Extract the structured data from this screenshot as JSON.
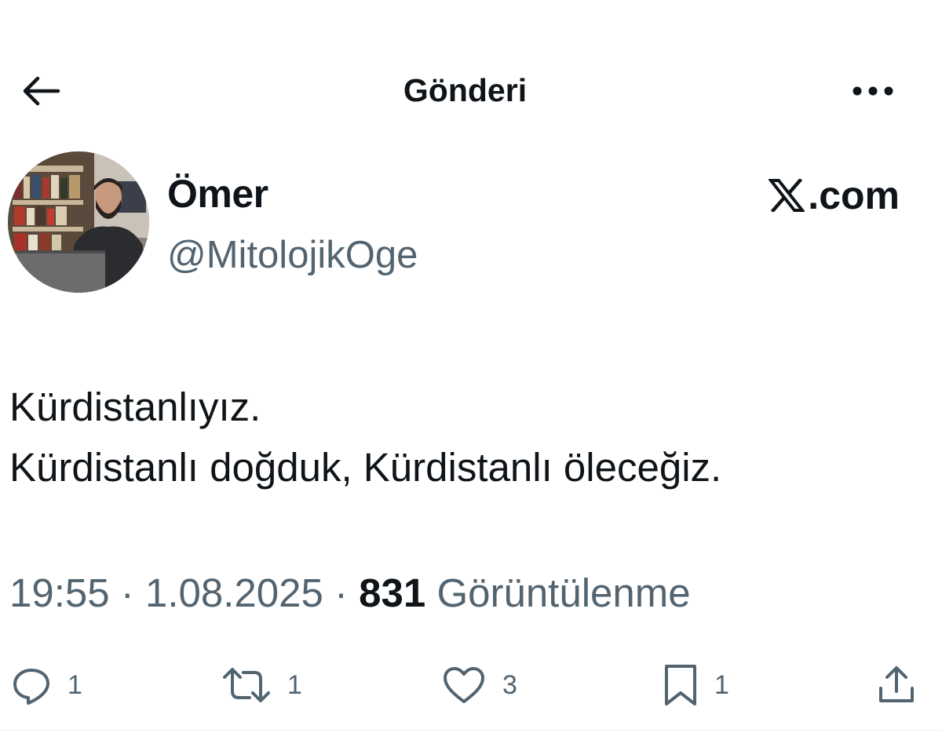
{
  "header": {
    "title": "Gönderi"
  },
  "author": {
    "name": "Ömer",
    "handle": "@MitolojikOge"
  },
  "brand": {
    "text": ".com"
  },
  "tweet": {
    "lines": [
      "Kürdistanlıyız.",
      "Kürdistanlı doğduk, Kürdistanlı öleceğiz."
    ]
  },
  "meta": {
    "time": "19:55",
    "separator": "·",
    "date": "1.08.2025",
    "views_count": "831",
    "views_label": "Görüntülenme"
  },
  "actions": {
    "reply_count": "1",
    "retweet_count": "1",
    "like_count": "3",
    "bookmark_count": "1"
  },
  "colors": {
    "text_primary": "#0f1419",
    "text_secondary": "#536471",
    "divider": "#eff3f4"
  },
  "icons": {
    "back": "arrow-left-icon",
    "more": "more-horizontal-icon",
    "brand": "x-logo-icon",
    "reply": "reply-icon",
    "retweet": "retweet-icon",
    "like": "heart-icon",
    "bookmark": "bookmark-icon",
    "share": "share-icon"
  }
}
